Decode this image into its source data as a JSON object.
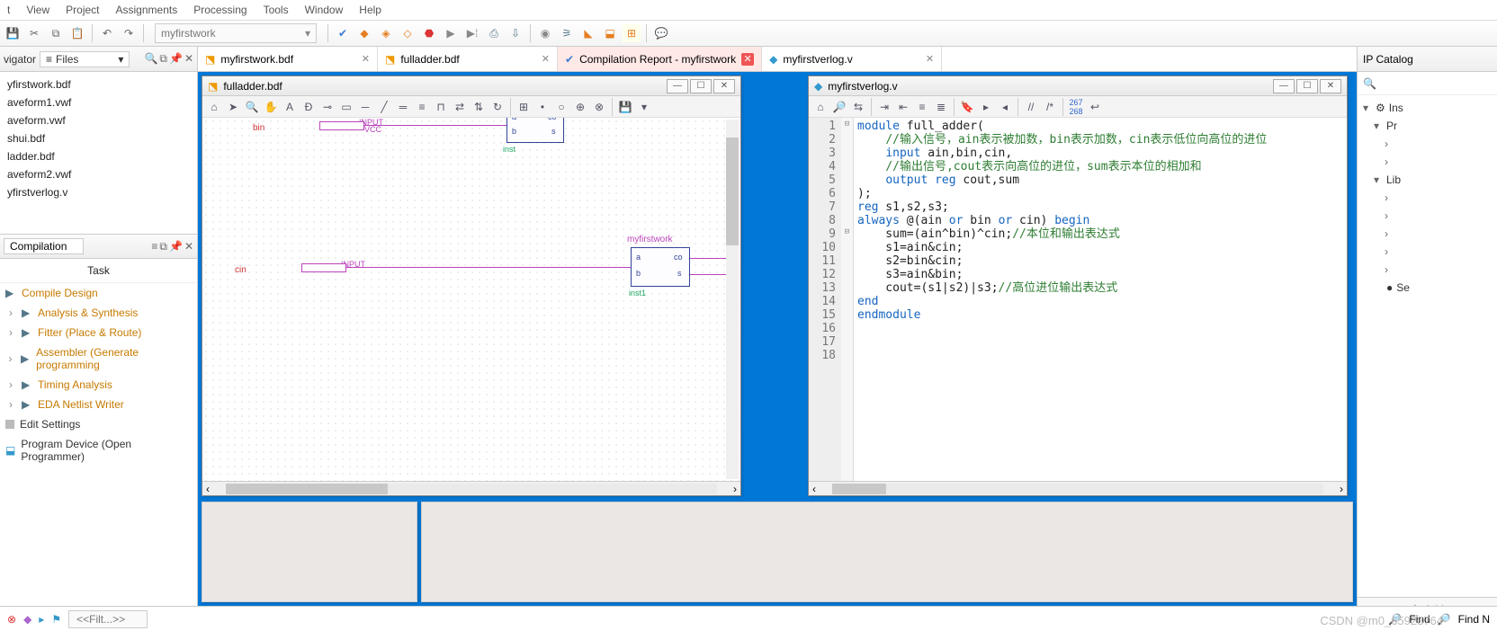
{
  "menu": [
    "t",
    "View",
    "Project",
    "Assignments",
    "Processing",
    "Tools",
    "Window",
    "Help"
  ],
  "project_name": "myfirstwork",
  "navigator": {
    "title": "vigator",
    "mode_label": "Files",
    "files": [
      "yfirstwork.bdf",
      "aveform1.vwf",
      "aveform.vwf",
      "shui.bdf",
      "ladder.bdf",
      "aveform2.vwf",
      "yfirstverlog.v"
    ]
  },
  "compilation": {
    "dropdown": "Compilation",
    "task_header": "Task",
    "tasks": [
      {
        "label": "Compile Design",
        "style": "link",
        "dbl": false
      },
      {
        "label": "Analysis & Synthesis",
        "style": "link",
        "dbl": true
      },
      {
        "label": "Fitter (Place & Route)",
        "style": "link",
        "dbl": true
      },
      {
        "label": "Assembler (Generate programming",
        "style": "link",
        "dbl": true
      },
      {
        "label": "Timing Analysis",
        "style": "link",
        "dbl": true
      },
      {
        "label": "EDA Netlist Writer",
        "style": "link",
        "dbl": true
      },
      {
        "label": "Edit Settings",
        "style": "plain",
        "icon": "gear"
      },
      {
        "label": "Program Device (Open Programmer)",
        "style": "plain",
        "icon": "chip"
      }
    ]
  },
  "doc_tabs": [
    {
      "label": "myfirstwork.bdf",
      "icon": "bdf",
      "closable": true
    },
    {
      "label": "fulladder.bdf",
      "icon": "bdf",
      "closable": true
    },
    {
      "label": "Compilation Report - myfirstwork",
      "icon": "report",
      "closable": true,
      "hl": true
    },
    {
      "label": "myfirstverlog.v",
      "icon": "v",
      "closable": true
    }
  ],
  "bdf_window": {
    "title": "fulladder.bdf",
    "labels": {
      "bin": "bin",
      "cin": "cin",
      "input1": "INPUT",
      "input2": "INPUT",
      "vcc": "VCC",
      "inst": "inst",
      "inst1": "inst1",
      "a": "a",
      "b": "b",
      "co": "co",
      "s": "s",
      "myfirstwork": "myfirstwork"
    }
  },
  "verilog_window": {
    "title": "myfirstverlog.v",
    "lines": [
      {
        "n": 1,
        "fold": "⊟",
        "html": "<span class='kw'>module</span> full_adder("
      },
      {
        "n": 2,
        "fold": "",
        "html": "    <span class='cm'>//输入信号，ain表示被加数，bin表示加数，cin表示低位向高位的进位</span>"
      },
      {
        "n": 3,
        "fold": "",
        "html": "    <span class='kw'>input</span> ain,bin,cin,"
      },
      {
        "n": 4,
        "fold": "",
        "html": "    <span class='cm'>//输出信号,cout表示向高位的进位，sum表示本位的相加和</span>"
      },
      {
        "n": 5,
        "fold": "",
        "html": "    <span class='kw'>output reg</span> cout,sum"
      },
      {
        "n": 6,
        "fold": "",
        "html": ""
      },
      {
        "n": 7,
        "fold": "",
        "html": ");"
      },
      {
        "n": 8,
        "fold": "",
        "html": "<span class='kw'>reg</span> s1,s2,s3;"
      },
      {
        "n": 9,
        "fold": "⊟",
        "html": "<span class='kw'>always</span> @(ain <span class='kw'>or</span> bin <span class='kw'>or</span> cin) <span class='kw'>begin</span>"
      },
      {
        "n": 10,
        "fold": "",
        "html": "    sum=(ain^bin)^cin;<span class='cm'>//本位和输出表达式</span>"
      },
      {
        "n": 11,
        "fold": "",
        "html": "    s1=ain&amp;cin;"
      },
      {
        "n": 12,
        "fold": "",
        "html": "    s2=bin&amp;cin;"
      },
      {
        "n": 13,
        "fold": "",
        "html": "    s3=ain&amp;bin;"
      },
      {
        "n": 14,
        "fold": "",
        "html": "    cout=(s1|s2)|s3;<span class='cm'>//高位进位输出表达式</span>"
      },
      {
        "n": 15,
        "fold": "",
        "html": "<span class='kw'>end</span>"
      },
      {
        "n": 16,
        "fold": "",
        "html": "<span class='kw'>endmodule</span>"
      },
      {
        "n": 17,
        "fold": "",
        "html": ""
      },
      {
        "n": 18,
        "fold": "",
        "html": ""
      }
    ]
  },
  "right_panel": {
    "title": "IP Catalog",
    "nodes": [
      {
        "caret": "▾",
        "icon": "gear",
        "label": "Ins"
      },
      {
        "caret": "▾",
        "icon": "",
        "label": "Pr",
        "indent": 1,
        "sub": true
      },
      {
        "caret": "›",
        "icon": "",
        "label": "",
        "indent": 2
      },
      {
        "caret": "›",
        "icon": "",
        "label": "",
        "indent": 2
      },
      {
        "caret": "▾",
        "icon": "",
        "label": "Lib",
        "indent": 1,
        "sub": true
      },
      {
        "caret": "›",
        "icon": "",
        "label": "",
        "indent": 2
      },
      {
        "caret": "›",
        "icon": "",
        "label": "",
        "indent": 2
      },
      {
        "caret": "›",
        "icon": "",
        "label": "",
        "indent": 2
      },
      {
        "caret": "›",
        "icon": "",
        "label": "",
        "indent": 2
      },
      {
        "caret": "›",
        "icon": "",
        "label": "",
        "indent": 2
      },
      {
        "caret": "",
        "icon": "dot",
        "label": "Se",
        "indent": 1
      }
    ],
    "add_label": "Add"
  },
  "statusbar": {
    "find_next": "Find",
    "find_prev": "Find N"
  },
  "watermark": "CSDN @m0_65923764"
}
